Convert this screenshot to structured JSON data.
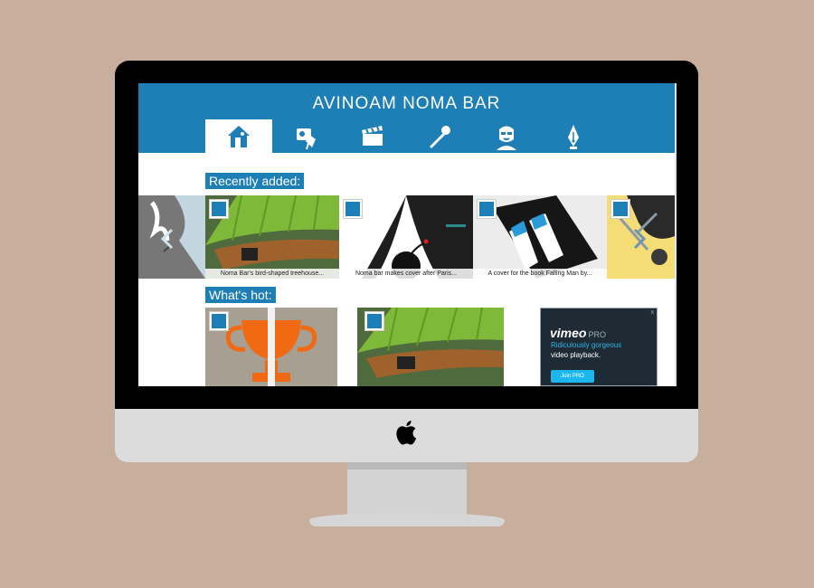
{
  "site": {
    "title": "AVINOAM NOMA BAR",
    "nav": [
      {
        "icon": "home-icon",
        "active": true
      },
      {
        "icon": "pin-icon",
        "active": false
      },
      {
        "icon": "clapperboard-icon",
        "active": false
      },
      {
        "icon": "microphone-icon",
        "active": false
      },
      {
        "icon": "portrait-icon",
        "active": false
      },
      {
        "icon": "pen-nib-icon",
        "active": false
      }
    ]
  },
  "recent": {
    "label": "Recently added:",
    "cards": [
      {
        "caption": ""
      },
      {
        "caption": "Noma Bar's bird-shaped treehouse..."
      },
      {
        "caption": "Noma bar makes cover after Paris..."
      },
      {
        "caption": "A cover for the book Falling Man by..."
      },
      {
        "caption": ""
      }
    ]
  },
  "hot": {
    "label": "What's hot:"
  },
  "ad": {
    "brand": "vimeo",
    "brand_suffix": "PRO",
    "line1": "Ridiculously gorgeous",
    "line2": "video playback.",
    "button": "Join PRO",
    "close": "x"
  },
  "colors": {
    "accent": "#1d7fb5",
    "background": "#c8ae9d"
  }
}
